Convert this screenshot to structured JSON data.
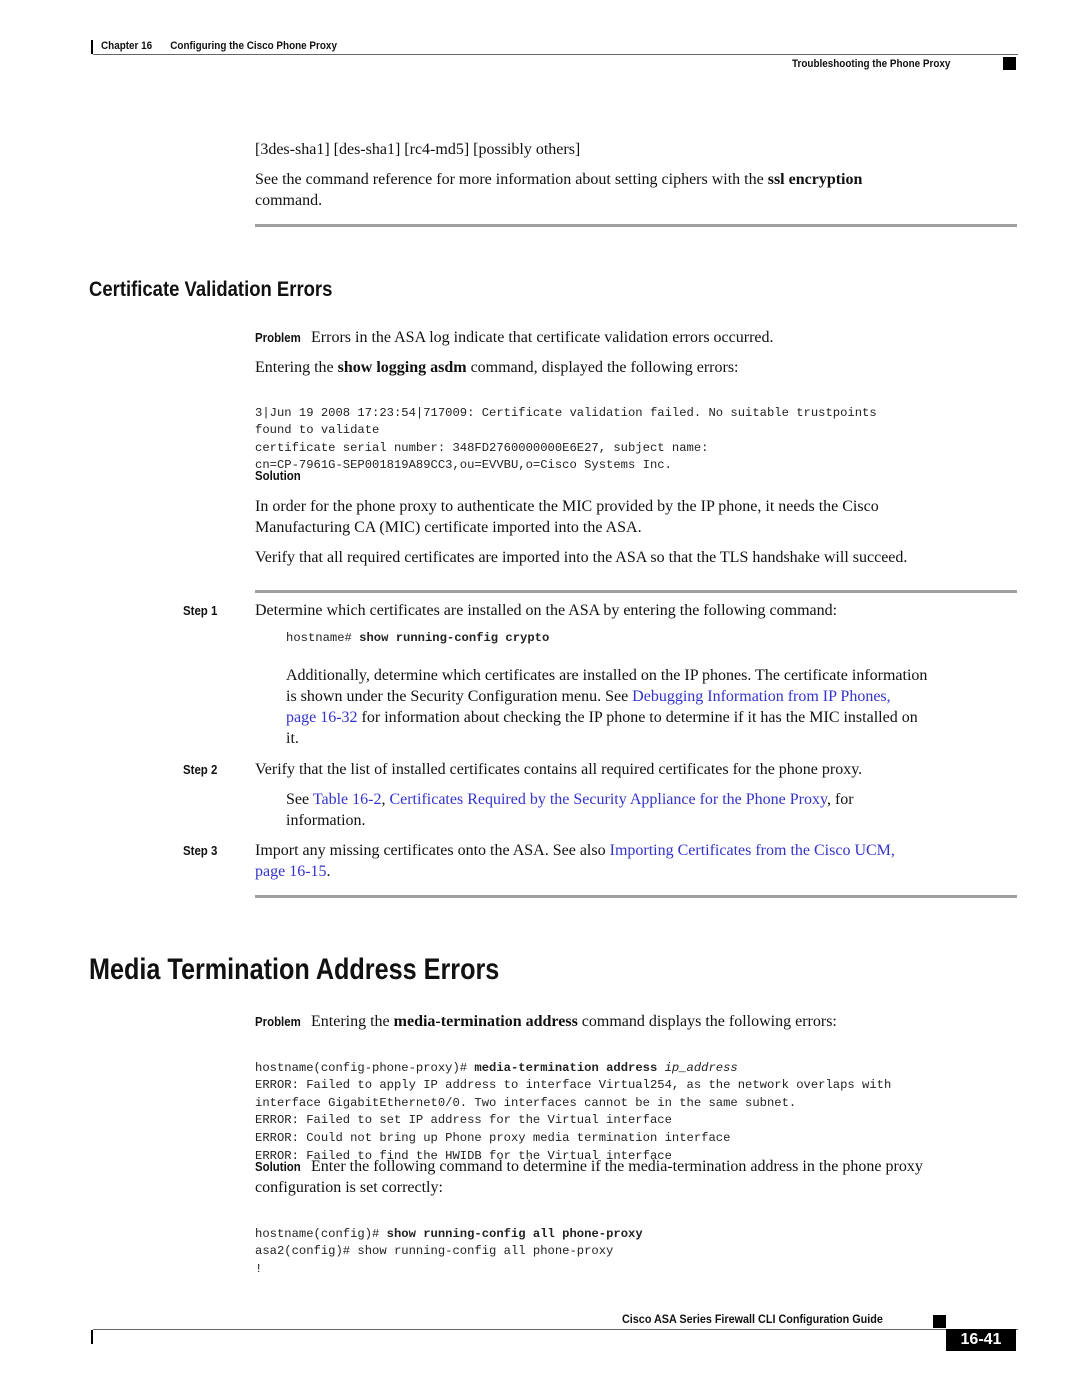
{
  "header": {
    "chapter": "Chapter 16",
    "chapter_title": "Configuring the Cisco Phone Proxy",
    "section": "Troubleshooting the Phone Proxy"
  },
  "top": {
    "ciphers": "[3des-sha1] [des-sha1] [rc4-md5] [possibly others]",
    "see_pre": "See the command reference for more information about setting ciphers with the ",
    "see_bold": "ssl encryption",
    "see_post": "command."
  },
  "cert_section": {
    "heading": "Certificate Validation Errors",
    "problem_label": "Problem",
    "problem_text": "Errors in the ASA log indicate that certificate validation errors occurred.",
    "entering_pre": "Entering the ",
    "entering_bold": "show logging asdm",
    "entering_post": " command, displayed the following errors:",
    "log_lines": [
      "3|Jun 19 2008 17:23:54|717009: Certificate validation failed. No suitable trustpoints",
      "found to validate",
      "certificate serial number: 348FD2760000000E6E27, subject name:",
      "cn=CP-7961G-SEP001819A89CC3,ou=EVVBU,o=Cisco Systems Inc."
    ],
    "solution_label": "Solution",
    "solution_p1_l1": "In order for the phone proxy to authenticate the MIC provided by the IP phone, it needs the Cisco",
    "solution_p1_l2": "Manufacturing CA (MIC) certificate imported into the ASA.",
    "solution_p2": "Verify that all required certificates are imported into the ASA so that the TLS handshake will succeed.",
    "steps": [
      {
        "label": "Step 1",
        "text": "Determine which certificates are installed on the ASA by entering the following command:",
        "cmd_prompt": "hostname# ",
        "cmd_bold": "show running-config crypto",
        "extra_l1": "Additionally, determine which certificates are installed on the IP phones. The certificate information",
        "extra_l2_pre": "is shown under the Security Configuration menu. See ",
        "extra_l2_link": "Debugging Information from IP Phones,",
        "extra_l3_link": "page 16-32",
        "extra_l3_post": " for information about checking the IP phone to determine if it has the MIC installed on",
        "extra_l4": "it."
      },
      {
        "label": "Step 2",
        "text": "Verify that the list of installed certificates contains all required certificates for the phone proxy.",
        "see_pre": "See ",
        "see_link1": "Table 16-2",
        "see_comma": ", ",
        "see_link2": "Certificates Required by the Security Appliance for the Phone Proxy",
        "see_post": ", for",
        "see_l2": "information."
      },
      {
        "label": "Step 3",
        "text_pre": "Import any missing certificates onto the ASA. See also ",
        "text_link": "Importing Certificates from the Cisco UCM,",
        "text_l2_link": "page 16-15",
        "text_l2_post": "."
      }
    ]
  },
  "media_section": {
    "heading": "Media Termination Address Errors",
    "problem_label": "Problem",
    "problem_pre": "Entering the ",
    "problem_bold": "media-termination address",
    "problem_post": " command displays the following errors:",
    "cmd_prompt": "hostname(config-phone-proxy)# ",
    "cmd_bold": "media-termination address",
    "cmd_italic": "ip_address",
    "error_lines": [
      "ERROR: Failed to apply IP address to interface Virtual254, as the network overlaps with",
      "interface GigabitEthernet0/0. Two interfaces cannot be in the same subnet.",
      "ERROR: Failed to set IP address for the Virtual interface",
      "ERROR: Could not bring up Phone proxy media termination interface",
      "ERROR: Failed to find the HWIDB for the Virtual interface"
    ],
    "solution_label": "Solution",
    "solution_l1": "Enter the following command to determine if the media-termination address in the phone proxy",
    "solution_l2": "configuration is set correctly:",
    "cmd2_prompt": "hostname(config)# ",
    "cmd2_bold": "show running-config all phone-proxy",
    "cmd3": "asa2(config)# show running-config all phone-proxy",
    "cmd4": "!"
  },
  "footer": {
    "guide_title": "Cisco ASA Series Firewall CLI Configuration Guide",
    "page_number": "16-41"
  }
}
